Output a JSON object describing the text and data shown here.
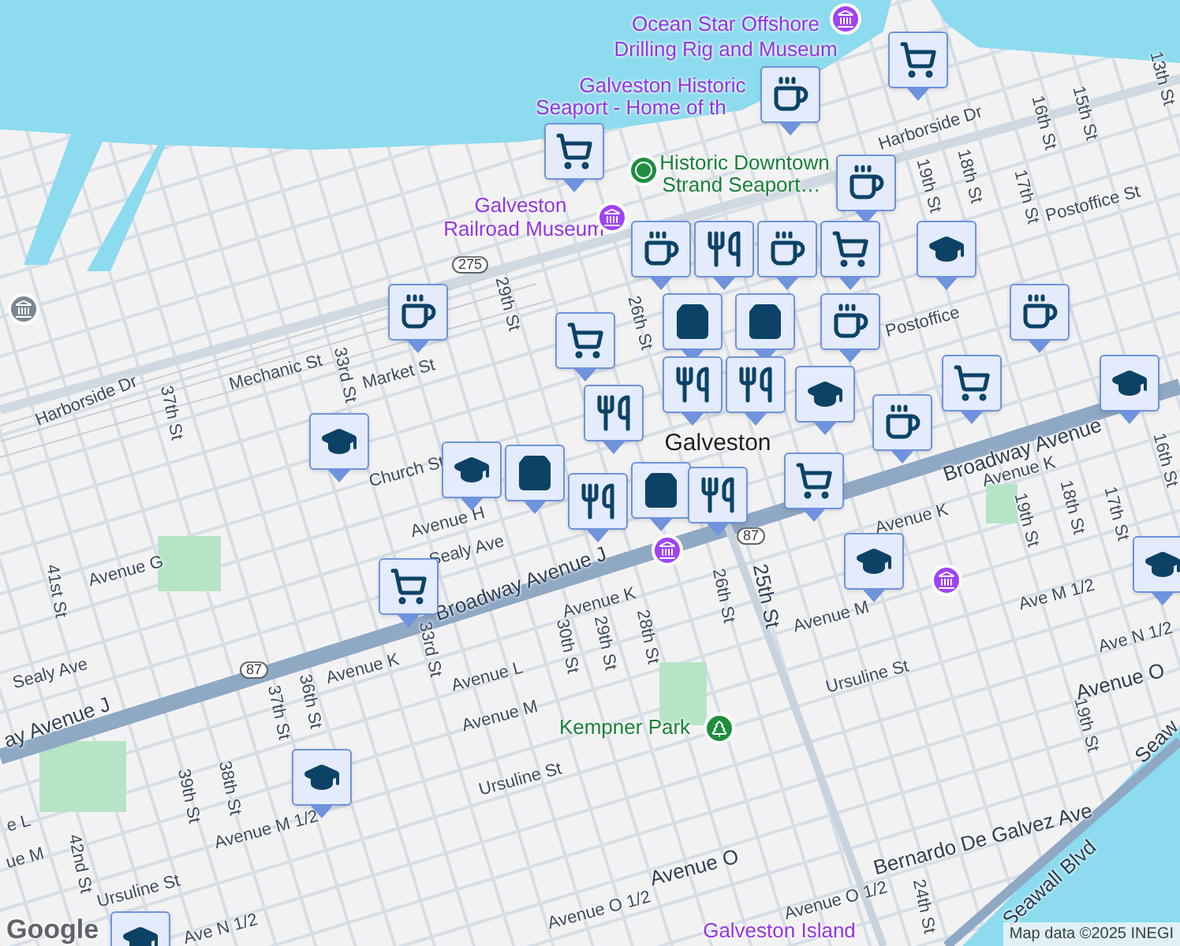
{
  "map": {
    "labels": [
      {
        "text": "Ocean Star Offshore",
        "kind": "museum"
      },
      {
        "text": "Drilling Rig and Museum",
        "kind": "museum"
      },
      {
        "text": "Galveston Historic",
        "kind": "museum"
      },
      {
        "text": "Seaport - Home of th",
        "kind": "museum"
      },
      {
        "text": "Harborside Dr",
        "kind": "street"
      },
      {
        "text": "13th St",
        "kind": "street"
      },
      {
        "text": "16th St",
        "kind": "street"
      },
      {
        "text": "15th St",
        "kind": "street"
      },
      {
        "text": "19th St",
        "kind": "street"
      },
      {
        "text": "18th St",
        "kind": "street"
      },
      {
        "text": "Historic Downtown",
        "kind": "park"
      },
      {
        "text": "Strand Seaport…",
        "kind": "park"
      },
      {
        "text": "Galveston",
        "kind": "museum"
      },
      {
        "text": "Railroad Museum",
        "kind": "museum"
      },
      {
        "text": "17th St",
        "kind": "street"
      },
      {
        "text": "Postoffice St",
        "kind": "street"
      },
      {
        "text": "275",
        "kind": "route"
      },
      {
        "text": "29th St",
        "kind": "street"
      },
      {
        "text": "26th St",
        "kind": "street"
      },
      {
        "text": "Postoffice",
        "kind": "street"
      },
      {
        "text": "Harborside Dr",
        "kind": "street"
      },
      {
        "text": "Mechanic St",
        "kind": "street"
      },
      {
        "text": "Market St",
        "kind": "street"
      },
      {
        "text": "37th St",
        "kind": "street"
      },
      {
        "text": "33rd St",
        "kind": "street"
      },
      {
        "text": "Church St",
        "kind": "street"
      },
      {
        "text": "Galveston",
        "kind": "city"
      },
      {
        "text": "Broadway Avenue",
        "kind": "major"
      },
      {
        "text": "16th St",
        "kind": "street"
      },
      {
        "text": "Avenue K",
        "kind": "street"
      },
      {
        "text": "Avenue H",
        "kind": "street"
      },
      {
        "text": "Sealy Ave",
        "kind": "street"
      },
      {
        "text": "87",
        "kind": "route"
      },
      {
        "text": "Avenue G",
        "kind": "street"
      },
      {
        "text": "Broadway Avenue J",
        "kind": "major"
      },
      {
        "text": "Avenue K",
        "kind": "street"
      },
      {
        "text": "19th St",
        "kind": "street"
      },
      {
        "text": "18th St",
        "kind": "street"
      },
      {
        "text": "17th St",
        "kind": "street"
      },
      {
        "text": "41st St",
        "kind": "street"
      },
      {
        "text": "Sealy Ave",
        "kind": "street"
      },
      {
        "text": "87",
        "kind": "route"
      },
      {
        "text": "33rd St",
        "kind": "street"
      },
      {
        "text": "30th St",
        "kind": "street"
      },
      {
        "text": "29th St",
        "kind": "street"
      },
      {
        "text": "28th St",
        "kind": "street"
      },
      {
        "text": "26th St",
        "kind": "street"
      },
      {
        "text": "25th St",
        "kind": "major"
      },
      {
        "text": "Avenue M",
        "kind": "street"
      },
      {
        "text": "Ave M 1/2",
        "kind": "street"
      },
      {
        "text": "Ave N 1/2",
        "kind": "street"
      },
      {
        "text": "ay Avenue J",
        "kind": "major"
      },
      {
        "text": "36th St",
        "kind": "street"
      },
      {
        "text": "37th St",
        "kind": "street"
      },
      {
        "text": "Avenue K",
        "kind": "street"
      },
      {
        "text": "Avenue L",
        "kind": "street"
      },
      {
        "text": "Avenue M",
        "kind": "street"
      },
      {
        "text": "Avenue K",
        "kind": "street"
      },
      {
        "text": "Avenue O",
        "kind": "major"
      },
      {
        "text": "Ursuline St",
        "kind": "street"
      },
      {
        "text": "Ursuline St",
        "kind": "street"
      },
      {
        "text": "Kempner Park",
        "kind": "park"
      },
      {
        "text": "38th St",
        "kind": "street"
      },
      {
        "text": "39th St",
        "kind": "street"
      },
      {
        "text": "e L",
        "kind": "street"
      },
      {
        "text": "Avenue M 1/2",
        "kind": "street"
      },
      {
        "text": "19th St",
        "kind": "street"
      },
      {
        "text": "Seaw",
        "kind": "major"
      },
      {
        "text": "ue M",
        "kind": "street"
      },
      {
        "text": "Bernardo De Galvez Ave",
        "kind": "major"
      },
      {
        "text": "Avenue O",
        "kind": "major"
      },
      {
        "text": "Ursuline St",
        "kind": "street"
      },
      {
        "text": "42nd St",
        "kind": "street"
      },
      {
        "text": "Avenue O 1/2",
        "kind": "street"
      },
      {
        "text": "Avenue O 1/2",
        "kind": "street"
      },
      {
        "text": "Seawall Blvd",
        "kind": "major"
      },
      {
        "text": "24th St",
        "kind": "street"
      },
      {
        "text": "Ave N 1/2",
        "kind": "street"
      },
      {
        "text": "Galveston Island",
        "kind": "museum"
      }
    ],
    "markers": [
      {
        "kind": "museum"
      },
      {
        "kind": "grocery"
      },
      {
        "kind": "cafe"
      },
      {
        "kind": "grocery"
      },
      {
        "kind": "landmark"
      },
      {
        "kind": "cafe"
      },
      {
        "kind": "museum"
      },
      {
        "kind": "cafe"
      },
      {
        "kind": "restaurant"
      },
      {
        "kind": "cafe"
      },
      {
        "kind": "grocery"
      },
      {
        "kind": "school"
      },
      {
        "kind": "shopping"
      },
      {
        "kind": "shopping"
      },
      {
        "kind": "grocery"
      },
      {
        "kind": "cafe"
      },
      {
        "kind": "building"
      },
      {
        "kind": "restaurant"
      },
      {
        "kind": "restaurant"
      },
      {
        "kind": "school"
      },
      {
        "kind": "cafe"
      },
      {
        "kind": "grocery"
      },
      {
        "kind": "school"
      },
      {
        "kind": "school"
      },
      {
        "kind": "school"
      },
      {
        "kind": "shopping"
      },
      {
        "kind": "restaurant"
      },
      {
        "kind": "shopping"
      },
      {
        "kind": "museum"
      },
      {
        "kind": "restaurant"
      },
      {
        "kind": "grocery"
      },
      {
        "kind": "grocery"
      },
      {
        "kind": "school"
      },
      {
        "kind": "museum"
      },
      {
        "kind": "park"
      },
      {
        "kind": "school"
      },
      {
        "kind": "school"
      },
      {
        "kind": "cafe"
      },
      {
        "kind": "cafe"
      },
      {
        "kind": "restaurant"
      },
      {
        "kind": "school"
      }
    ],
    "logo": "Google",
    "attribution": "Map data ©2025 INEGI"
  }
}
